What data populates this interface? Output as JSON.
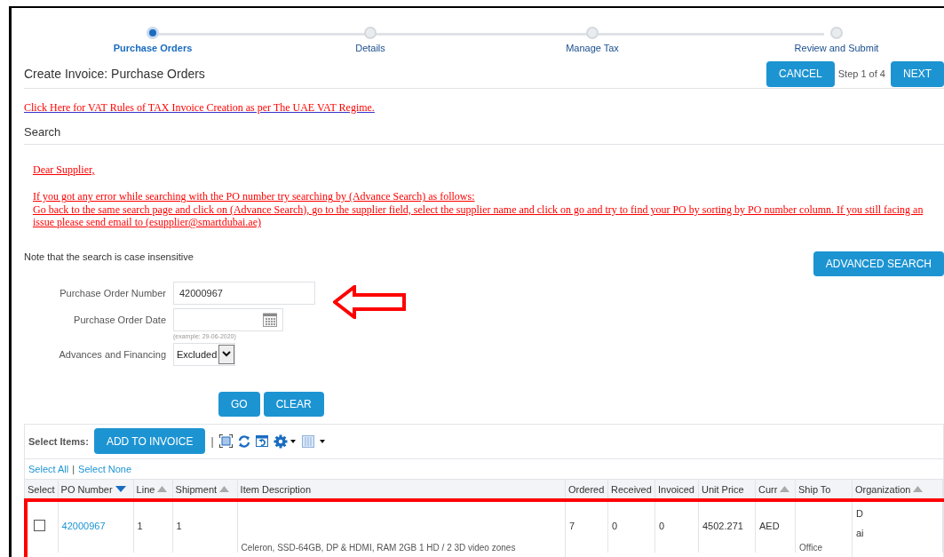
{
  "steps": [
    {
      "label": "Purchase Orders",
      "selected": true
    },
    {
      "label": "Details",
      "selected": false
    },
    {
      "label": "Manage Tax",
      "selected": false
    },
    {
      "label": "Review and Submit",
      "selected": false
    }
  ],
  "header": {
    "title": "Create Invoice: Purchase Orders",
    "cancel": "CANCEL",
    "step_text": "Step 1 of 4",
    "next": "NEXT"
  },
  "vat_link": "Click Here for VAT Rules of TAX Invoice Creation as per The UAE VAT Regime.",
  "search_title": "Search",
  "notice": [
    "Dear Supplier,",
    "If you got any error while searching with the PO number try searching by (Advance Search) as follows:\nGo back to the same search page and click on (Advance Search), go to the supplier field, select the supplier name and click on go and try to find your PO by sorting by PO number column. If you still facing an issue please send email to (esupplier@smartdubai.ae)"
  ],
  "note": "Note that the search is case insensitive",
  "advanced_search": "ADVANCED SEARCH",
  "form": {
    "po_number_label": "Purchase Order Number",
    "po_number": "42000967",
    "po_date_label": "Purchase Order Date",
    "po_date_hint": "(example: 29-06-2020)",
    "advances_label": "Advances and Financing",
    "advances": "Excluded",
    "go": "GO",
    "clear": "CLEAR"
  },
  "toolbar": {
    "label": "Select Items:",
    "add": "ADD TO INVOICE",
    "select_all": "Select All",
    "separator": "|",
    "select_none": "Select None"
  },
  "table": {
    "columns": [
      {
        "label": "Select",
        "sorted": false
      },
      {
        "label": "PO Number",
        "sorted": true,
        "descending": true
      },
      {
        "label": "Line",
        "sorted": true,
        "descending": false
      },
      {
        "label": "Shipment",
        "sorted": true,
        "descending": false
      },
      {
        "label": "Item Description",
        "sorted": false
      },
      {
        "label": "Ordered",
        "sorted": false
      },
      {
        "label": "Received",
        "sorted": false
      },
      {
        "label": "Invoiced",
        "sorted": false
      },
      {
        "label": "Unit Price",
        "sorted": false
      },
      {
        "label": "Curr",
        "sorted": true,
        "descending": false
      },
      {
        "label": "Ship To",
        "sorted": false
      },
      {
        "label": "Organization",
        "sorted": true,
        "descending": false
      }
    ],
    "rows": [
      {
        "checked": false,
        "po_number": "42000967",
        "line": "1",
        "shipment": "1",
        "description": "Celeron, SSD-64GB, DP & HDMI, RAM 2GB 1 HD / 2 3D video zones",
        "ordered": "7",
        "received": "0",
        "invoiced": "0",
        "unit_price": "4502.271",
        "curr": "AED",
        "ship_to": "Office",
        "organization": [
          "D",
          "ai"
        ]
      }
    ]
  }
}
